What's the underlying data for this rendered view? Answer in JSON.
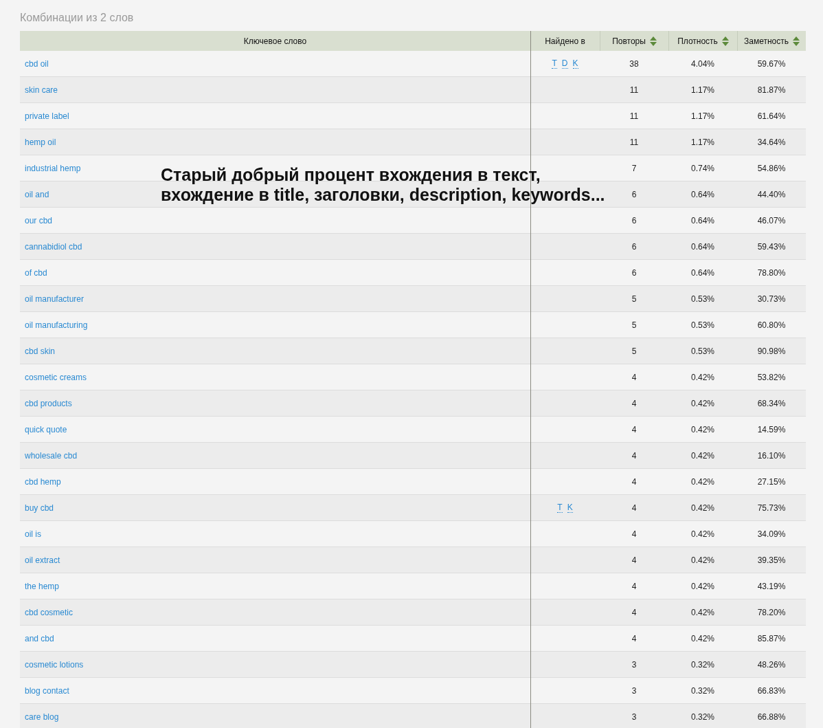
{
  "title": "Комбинации из 2 слов",
  "table": {
    "columns": [
      {
        "label": "Ключевое слово",
        "sortable": false
      },
      {
        "label": "Найдено в",
        "sortable": false
      },
      {
        "label": "Повторы",
        "sortable": true
      },
      {
        "label": "Плотность",
        "sortable": true
      },
      {
        "label": "Заметность",
        "sortable": true
      }
    ],
    "rows": [
      {
        "keyword": "cbd oil",
        "found_in": [
          "T",
          "D",
          "K"
        ],
        "repeats": "38",
        "density": "4.04%",
        "visibility": "59.67%"
      },
      {
        "keyword": "skin care",
        "found_in": [],
        "repeats": "11",
        "density": "1.17%",
        "visibility": "81.87%"
      },
      {
        "keyword": "private label",
        "found_in": [],
        "repeats": "11",
        "density": "1.17%",
        "visibility": "61.64%"
      },
      {
        "keyword": "hemp oil",
        "found_in": [],
        "repeats": "11",
        "density": "1.17%",
        "visibility": "34.64%"
      },
      {
        "keyword": "industrial hemp",
        "found_in": [],
        "repeats": "7",
        "density": "0.74%",
        "visibility": "54.86%"
      },
      {
        "keyword": "oil and",
        "found_in": [],
        "repeats": "6",
        "density": "0.64%",
        "visibility": "44.40%"
      },
      {
        "keyword": "our cbd",
        "found_in": [],
        "repeats": "6",
        "density": "0.64%",
        "visibility": "46.07%"
      },
      {
        "keyword": "cannabidiol cbd",
        "found_in": [],
        "repeats": "6",
        "density": "0.64%",
        "visibility": "59.43%"
      },
      {
        "keyword": "of cbd",
        "found_in": [],
        "repeats": "6",
        "density": "0.64%",
        "visibility": "78.80%"
      },
      {
        "keyword": "oil manufacturer",
        "found_in": [],
        "repeats": "5",
        "density": "0.53%",
        "visibility": "30.73%"
      },
      {
        "keyword": "oil manufacturing",
        "found_in": [],
        "repeats": "5",
        "density": "0.53%",
        "visibility": "60.80%"
      },
      {
        "keyword": "cbd skin",
        "found_in": [],
        "repeats": "5",
        "density": "0.53%",
        "visibility": "90.98%"
      },
      {
        "keyword": "cosmetic creams",
        "found_in": [],
        "repeats": "4",
        "density": "0.42%",
        "visibility": "53.82%"
      },
      {
        "keyword": "cbd products",
        "found_in": [],
        "repeats": "4",
        "density": "0.42%",
        "visibility": "68.34%"
      },
      {
        "keyword": "quick quote",
        "found_in": [],
        "repeats": "4",
        "density": "0.42%",
        "visibility": "14.59%"
      },
      {
        "keyword": "wholesale cbd",
        "found_in": [],
        "repeats": "4",
        "density": "0.42%",
        "visibility": "16.10%"
      },
      {
        "keyword": "cbd hemp",
        "found_in": [],
        "repeats": "4",
        "density": "0.42%",
        "visibility": "27.15%"
      },
      {
        "keyword": "buy cbd",
        "found_in": [
          "T",
          "K"
        ],
        "repeats": "4",
        "density": "0.42%",
        "visibility": "75.73%"
      },
      {
        "keyword": "oil is",
        "found_in": [],
        "repeats": "4",
        "density": "0.42%",
        "visibility": "34.09%"
      },
      {
        "keyword": "oil extract",
        "found_in": [],
        "repeats": "4",
        "density": "0.42%",
        "visibility": "39.35%"
      },
      {
        "keyword": "the hemp",
        "found_in": [],
        "repeats": "4",
        "density": "0.42%",
        "visibility": "43.19%"
      },
      {
        "keyword": "cbd cosmetic",
        "found_in": [],
        "repeats": "4",
        "density": "0.42%",
        "visibility": "78.20%"
      },
      {
        "keyword": "and cbd",
        "found_in": [],
        "repeats": "4",
        "density": "0.42%",
        "visibility": "85.87%"
      },
      {
        "keyword": "cosmetic lotions",
        "found_in": [],
        "repeats": "3",
        "density": "0.32%",
        "visibility": "48.26%"
      },
      {
        "keyword": "blog contact",
        "found_in": [],
        "repeats": "3",
        "density": "0.32%",
        "visibility": "66.83%"
      },
      {
        "keyword": "care blog",
        "found_in": [],
        "repeats": "3",
        "density": "0.32%",
        "visibility": "66.88%"
      }
    ]
  },
  "annotation": [
    "Старый добрый процент вхождения в текст,",
    "вхождение в title, заголовки, description, keywords..."
  ]
}
